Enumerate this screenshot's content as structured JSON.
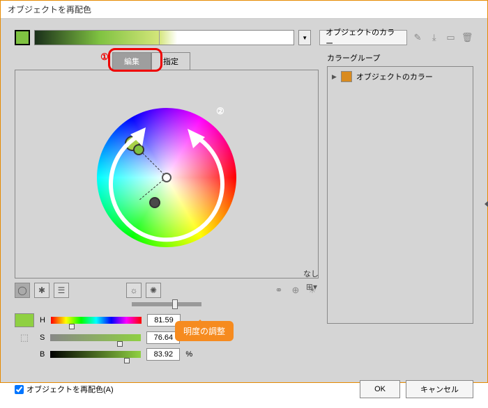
{
  "window": {
    "title": "オブジェクトを再配色"
  },
  "top": {
    "preset_label": "オブジェクトのカラー",
    "icons": {
      "wand": "wand-icon",
      "save": "save-icon",
      "folder": "folder-icon",
      "trash": "trash-icon"
    }
  },
  "tabs": {
    "edit": "編集",
    "assign": "指定"
  },
  "annotations": {
    "badge1": "①",
    "badge2": "②",
    "bubble": "明度の調整"
  },
  "controls": {
    "none_label": "なし",
    "slider_value": 50,
    "wheel_modes": [
      "smooth",
      "segmented",
      "bars"
    ]
  },
  "hsb": {
    "h": {
      "label": "H",
      "value": "81.59",
      "unit": ""
    },
    "s": {
      "label": "S",
      "value": "76.64",
      "unit": "%"
    },
    "b": {
      "label": "B",
      "value": "83.92",
      "unit": "%"
    }
  },
  "color_group": {
    "title": "カラーグループ",
    "items": [
      {
        "label": "オブジェクトのカラー",
        "swatch": "#d98b1f"
      }
    ]
  },
  "footer": {
    "checkbox_label": "オブジェクトを再配色(A)",
    "checked": true,
    "ok": "OK",
    "cancel": "キャンセル"
  }
}
